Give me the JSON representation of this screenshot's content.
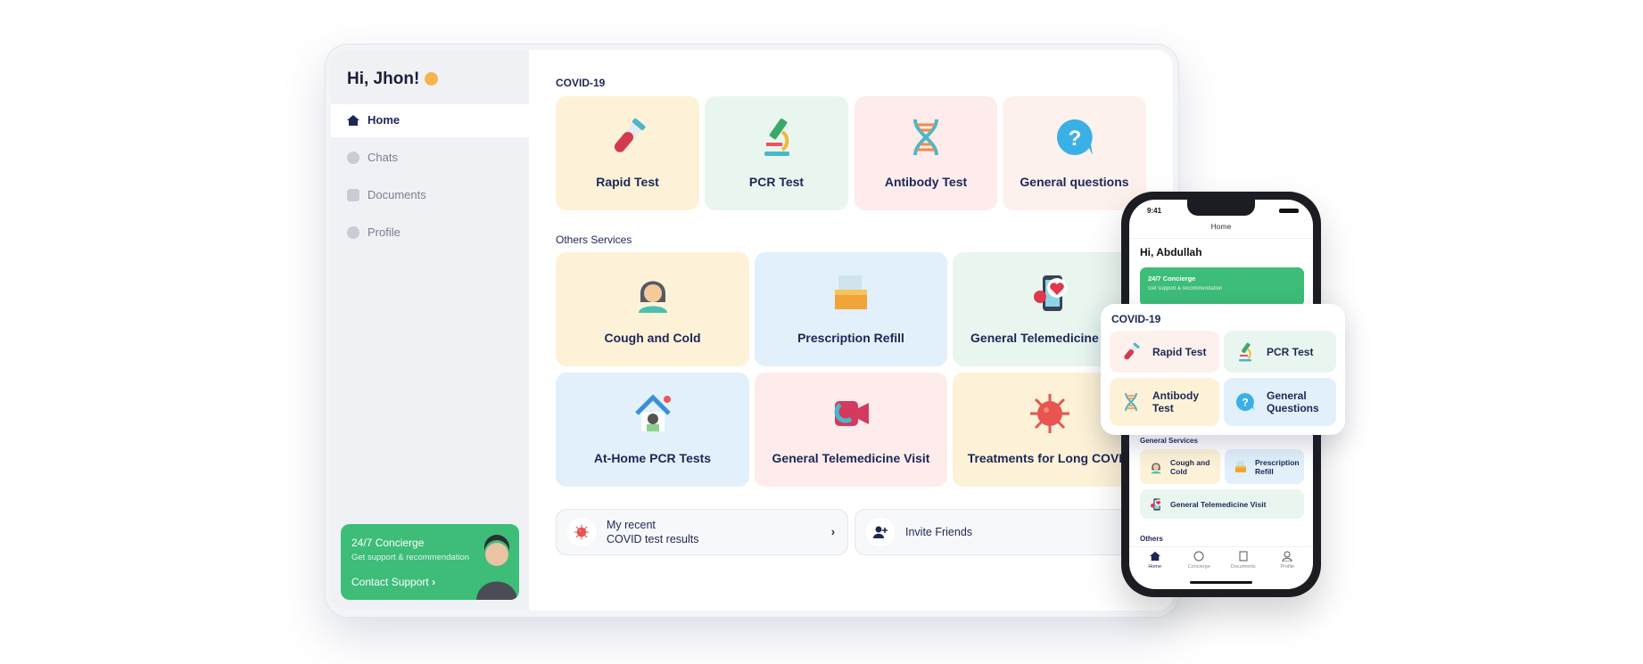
{
  "tablet": {
    "greeting": "Hi, Jhon!",
    "nav": [
      {
        "label": "Home",
        "icon": "home-icon",
        "active": true
      },
      {
        "label": "Chats",
        "icon": "chat-icon"
      },
      {
        "label": "Documents",
        "icon": "document-icon"
      },
      {
        "label": "Profile",
        "icon": "gear-icon"
      }
    ],
    "concierge": {
      "title": "24/7 Concierge",
      "subtitle": "Get support & recommendation",
      "action": "Contact Support"
    },
    "covid_title": "COVID-19",
    "covid": [
      {
        "label": "Rapid Test",
        "icon": "test-tube-icon"
      },
      {
        "label": "PCR Test",
        "icon": "microscope-icon"
      },
      {
        "label": "Antibody Test",
        "icon": "dna-icon"
      },
      {
        "label": "General questions",
        "icon": "question-bubble-icon"
      }
    ],
    "others_title": "Others Services",
    "others": [
      {
        "label": "Cough and Cold",
        "icon": "sick-person-icon"
      },
      {
        "label": "Prescription Refill",
        "icon": "medicine-box-icon"
      },
      {
        "label": "General Telemedicine Visit",
        "icon": "phone-heart-icon"
      },
      {
        "label": "At-Home PCR Tests",
        "icon": "house-icon"
      },
      {
        "label": "General Telemedicine Visit",
        "icon": "video-call-icon"
      },
      {
        "label": "Treatments for Long COVID",
        "icon": "virus-icon"
      }
    ],
    "recent_results": {
      "line1": "My recent",
      "line2": "COVID test results"
    },
    "invite": "Invite Friends"
  },
  "phone": {
    "time": "9:41",
    "title": "Home",
    "greeting": "Hi, Abdullah",
    "concierge": {
      "title": "24/7 Concierge",
      "subtitle": "Get support & recommendation"
    },
    "popup_title": "COVID-19",
    "popup": [
      {
        "label": "Rapid Test"
      },
      {
        "label": "PCR Test"
      },
      {
        "label": "Antibody Test"
      },
      {
        "label": "General Questions"
      }
    ],
    "general_title": "General Services",
    "general": [
      {
        "label": "Cough and Cold"
      },
      {
        "label": "Prescription Refill"
      },
      {
        "label": "General Telemedicine Visit"
      }
    ],
    "others_title": "Others",
    "tabs": [
      {
        "label": "Home"
      },
      {
        "label": "Concierge"
      },
      {
        "label": "Documents"
      },
      {
        "label": "Profile"
      }
    ]
  },
  "colors": {
    "accent": "#3dbd78",
    "text": "#1d2757"
  }
}
